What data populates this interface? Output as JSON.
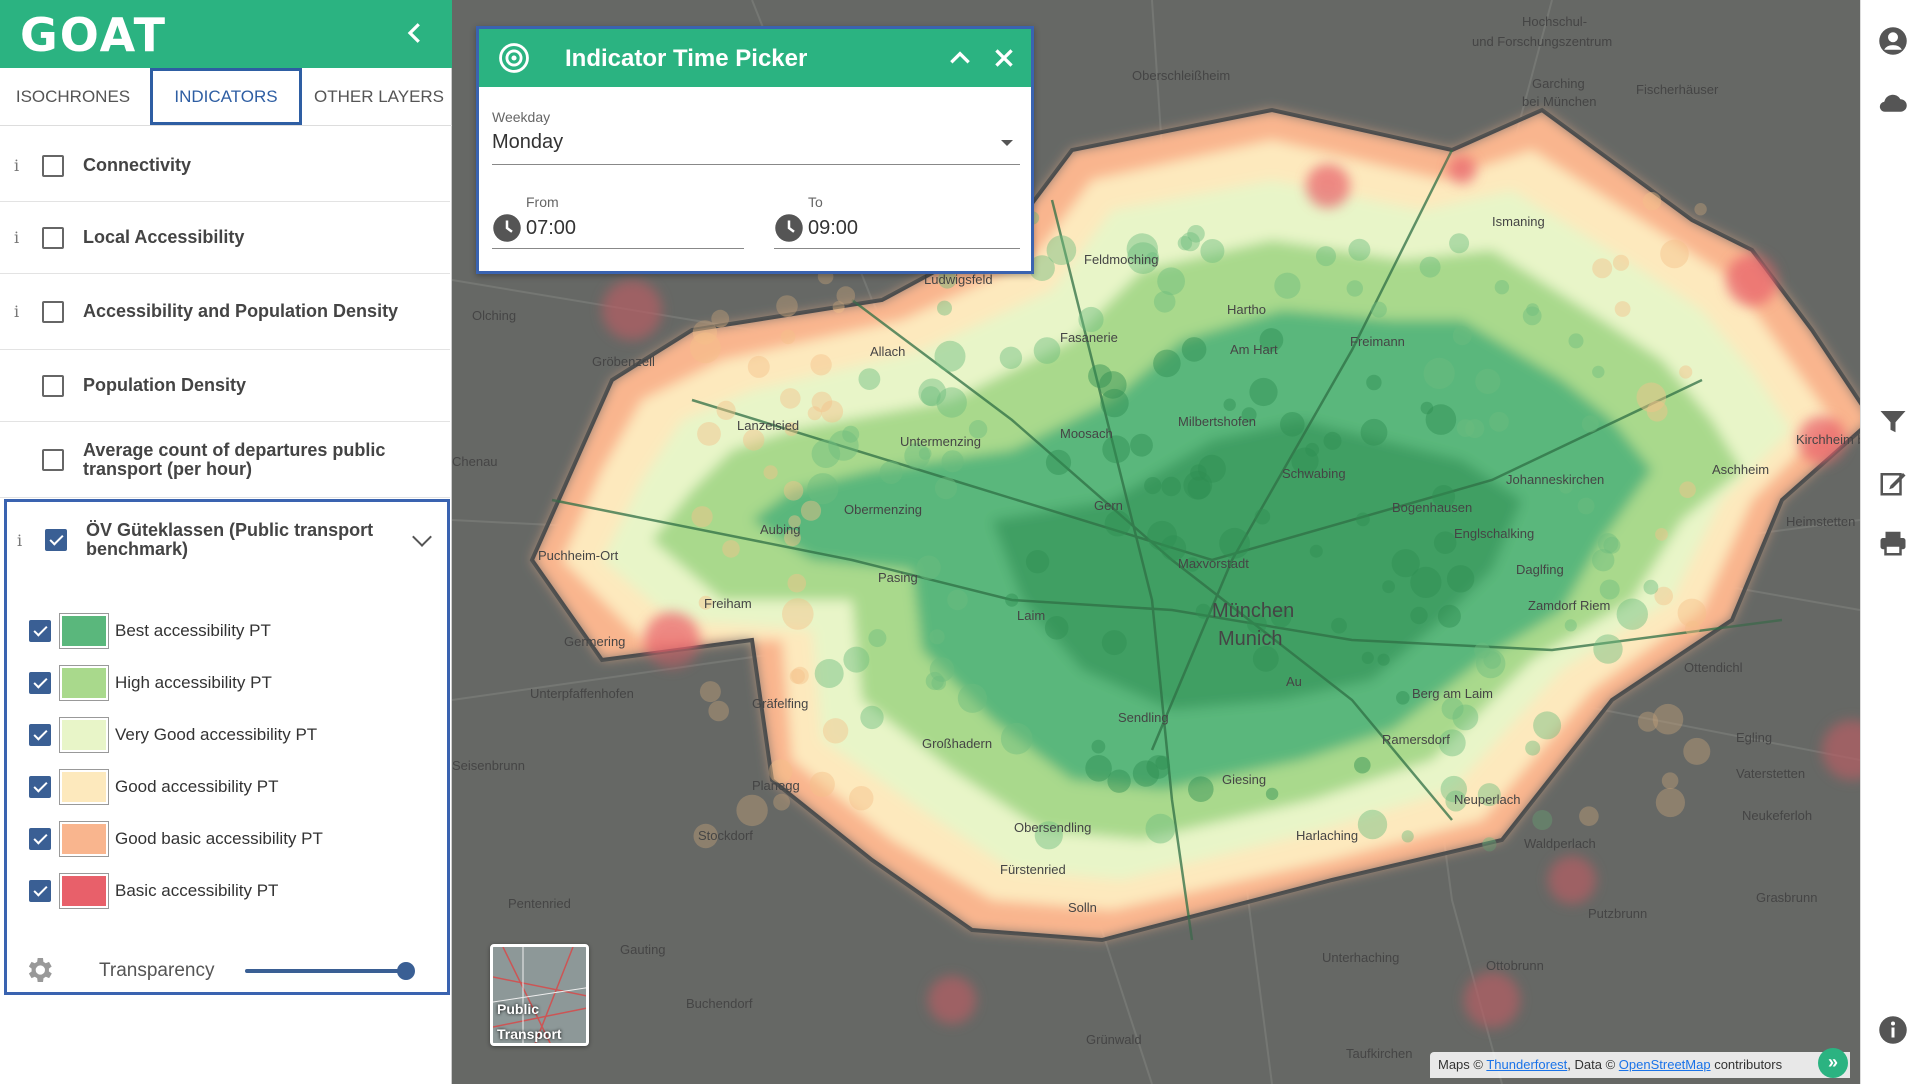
{
  "app": {
    "logo_text": "GOAT",
    "brand_color": "#2bb381",
    "accent_color": "#3a63b0"
  },
  "tabs": [
    {
      "label": "ISOCHRONES",
      "active": false
    },
    {
      "label": "INDICATORS",
      "active": true
    },
    {
      "label": "OTHER LAYERS",
      "active": false
    }
  ],
  "indicators": [
    {
      "label": "Connectivity",
      "checked": false,
      "info": "i"
    },
    {
      "label": "Local Accessibility",
      "checked": false,
      "info": "i"
    },
    {
      "label": "Accessibility and Population Density",
      "checked": false,
      "info": "i"
    },
    {
      "label": "Population Density",
      "checked": false
    },
    {
      "label": "Average count of departures public transport (per hour)",
      "checked": false
    },
    {
      "label": "ÖV Güteklassen (Public transport benchmark)",
      "checked": true,
      "info": "i"
    }
  ],
  "legend": [
    {
      "label": "Best accessibility PT",
      "color": "#5ab77c",
      "checked": true
    },
    {
      "label": "High accessibility PT",
      "color": "#a9d98c",
      "checked": true
    },
    {
      "label": "Very Good accessibility PT",
      "color": "#e8f5c8",
      "checked": true
    },
    {
      "label": "Good accessibility PT",
      "color": "#fde9bd",
      "checked": true
    },
    {
      "label": "Good basic accessibility PT",
      "color": "#f9b58e",
      "checked": true
    },
    {
      "label": "Basic accessibility PT",
      "color": "#e8606a",
      "checked": true
    }
  ],
  "transparency": {
    "label": "Transparency",
    "value": 1.0
  },
  "time_picker": {
    "title": "Indicator Time Picker",
    "weekday_label": "Weekday",
    "weekday_value": "Monday",
    "from_label": "From",
    "from_value": "07:00",
    "to_label": "To",
    "to_value": "09:00"
  },
  "map_labels": [
    "Hochschul-",
    "und Forschungszentrum",
    "Oberschleißheim",
    "Garching",
    "bei München",
    "Fischerhäuser",
    "Ismaning",
    "Feldmoching",
    "Ludwigsfeld",
    "Olching",
    "Gröbenzell",
    "Allach",
    "Fasanerie",
    "Hartho",
    "Am Hart",
    "Freimann",
    "Lanzelsied",
    "Untermenzing",
    "Moosach",
    "Milbertshofen",
    "Schwabing",
    "Johanneskirchen",
    "Kirchheim bei München",
    "Aschheim",
    "Heimstetten",
    "Obermenzing",
    "Aubing",
    "Gern",
    "Bogenhausen",
    "Englschalking",
    "Daglfing",
    "Maxvorstadt",
    "Puchheim-Ort",
    "Pasing",
    "Laim",
    "Zamdorf",
    "Riem",
    "Freiham",
    "München",
    "Munich",
    "Germering",
    "Au",
    "Berg am Laim",
    "Ottendichl",
    "Unterpfaffenhofen",
    "Gräfelfing",
    "Sendling",
    "Ramersdorf",
    "Egling",
    "Großhadern",
    "Giesing",
    "Vaterstetten",
    "Planegg",
    "Neuperlach",
    "Neukeferloh",
    "Stockdorf",
    "Obersendling",
    "Harlaching",
    "Waldperlach",
    "Fürstenried",
    "Solln",
    "Putzbrunn",
    "Grasbrunn",
    "Pentenried",
    "Gauting",
    "Unterhaching",
    "Ottobrunn",
    "Buchendorf",
    "Grünwald",
    "Taufkirchen",
    "Seisenbrunn",
    "Chenau"
  ],
  "basemap": {
    "label": "Public Transport"
  },
  "attribution": {
    "prefix": "Maps © ",
    "link1": "Thunderforest",
    "middle": ", Data © ",
    "link2": "OpenStreetMap",
    "suffix": " contributors",
    "button": "»"
  },
  "icons": {
    "collapse": "chevron-left-icon",
    "user": "account-icon",
    "cloud": "cloud-icon",
    "filter": "filter-icon",
    "edit": "edit-icon",
    "print": "printer-icon",
    "info": "info-icon",
    "tp_header": "target-icon",
    "tp_collapse": "chevron-up-icon",
    "tp_close": "close-icon",
    "clock": "clock-icon",
    "settings": "gear-icon"
  }
}
